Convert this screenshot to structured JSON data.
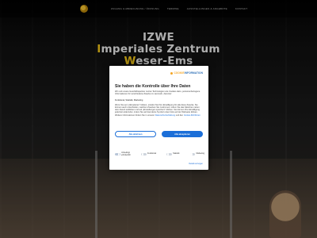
{
  "nav": {
    "items": [
      "ZUGANG & ABRECHNUNG / ÖFFNUNG",
      "TERMINE",
      "AUSSTELLUNGEN & ANGEBOTE",
      "KONTAKT"
    ]
  },
  "hero": {
    "line1": "IZWE",
    "line2_initial": "I",
    "line2_rest": "mperiales Zentrum",
    "line3_initial": "W",
    "line3_rest": "eser-Ems"
  },
  "cookie_dialog": {
    "brand": {
      "part1": "COOKIE",
      "part2": "INFORMATION"
    },
    "title": "Sie haben die Kontrolle über Ihre Daten",
    "text1": "Wir und unsere Geschäftspartner nutzen Technologien wie Cookies dazu, personenbezogene Informationen für verschiedene Zwecke zu sammeln, darunter:",
    "text2": "Funktional, Statistik, Marketing",
    "text3": "Wenn Sie auf „Akzeptieren\" klicken, erteilen Sie Ihre Einwilligung für alle diese Zwecke. Sie können auch entscheiden, welchen Zwecken Sie zustimmen, indem Sie das Kästchen neben dem Zweck anklicken und auf „Einstellungen speichern\" klicken. Sie können Ihre Einwilligung jederzeit widerrufen, indem Sie auf das kleine Symbol unten links auf der Webseite klicken. Weitere Informationen finden Sie in unserer",
    "privacy_link": "Datenschutzerklärung",
    "text3_end": "und den",
    "cookie_link": "Cookie-Richtlinien",
    "decline_label": "Alle ablehnen",
    "accept_label": "Alle akzeptieren",
    "toggles": [
      {
        "label": "Unbedingt erforderlich",
        "on": true
      },
      {
        "label": "Funktional",
        "on": false
      },
      {
        "label": "Statistik",
        "on": false
      },
      {
        "label": "Marketing",
        "on": false
      }
    ],
    "details_label": "Details anzeigen"
  }
}
